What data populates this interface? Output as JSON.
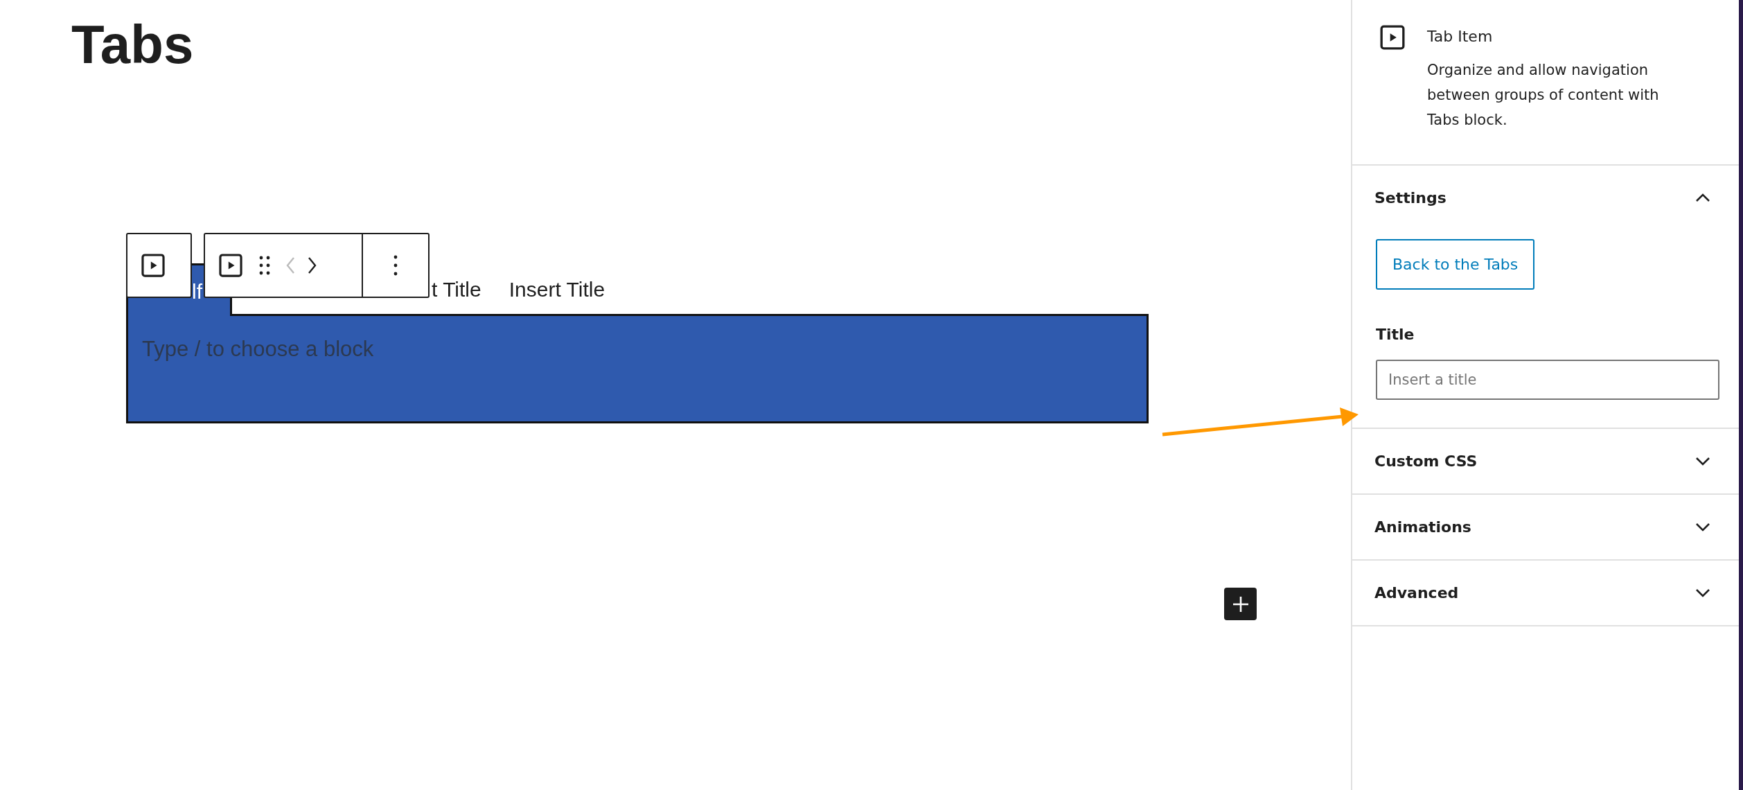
{
  "page_title": "Tabs",
  "tabs_block": {
    "tabs": [
      {
        "label": "lf",
        "selected": true
      },
      {
        "label": "t Title",
        "selected": false
      },
      {
        "label": "Insert Title",
        "selected": false
      }
    ],
    "content_placeholder": "Type / to choose a block"
  },
  "toolbar": {
    "previous_enabled": false,
    "next_enabled": true
  },
  "sidebar": {
    "block_title": "Tab Item",
    "block_description": "Organize and allow navigation between groups of content with Tabs block.",
    "panels": [
      {
        "title": "Settings",
        "expanded": true
      },
      {
        "title": "Custom CSS",
        "expanded": false
      },
      {
        "title": "Animations",
        "expanded": false
      },
      {
        "title": "Advanced",
        "expanded": false
      }
    ],
    "settings": {
      "back_button": "Back to the Tabs",
      "title_label": "Title",
      "title_placeholder": "Insert a title"
    }
  }
}
